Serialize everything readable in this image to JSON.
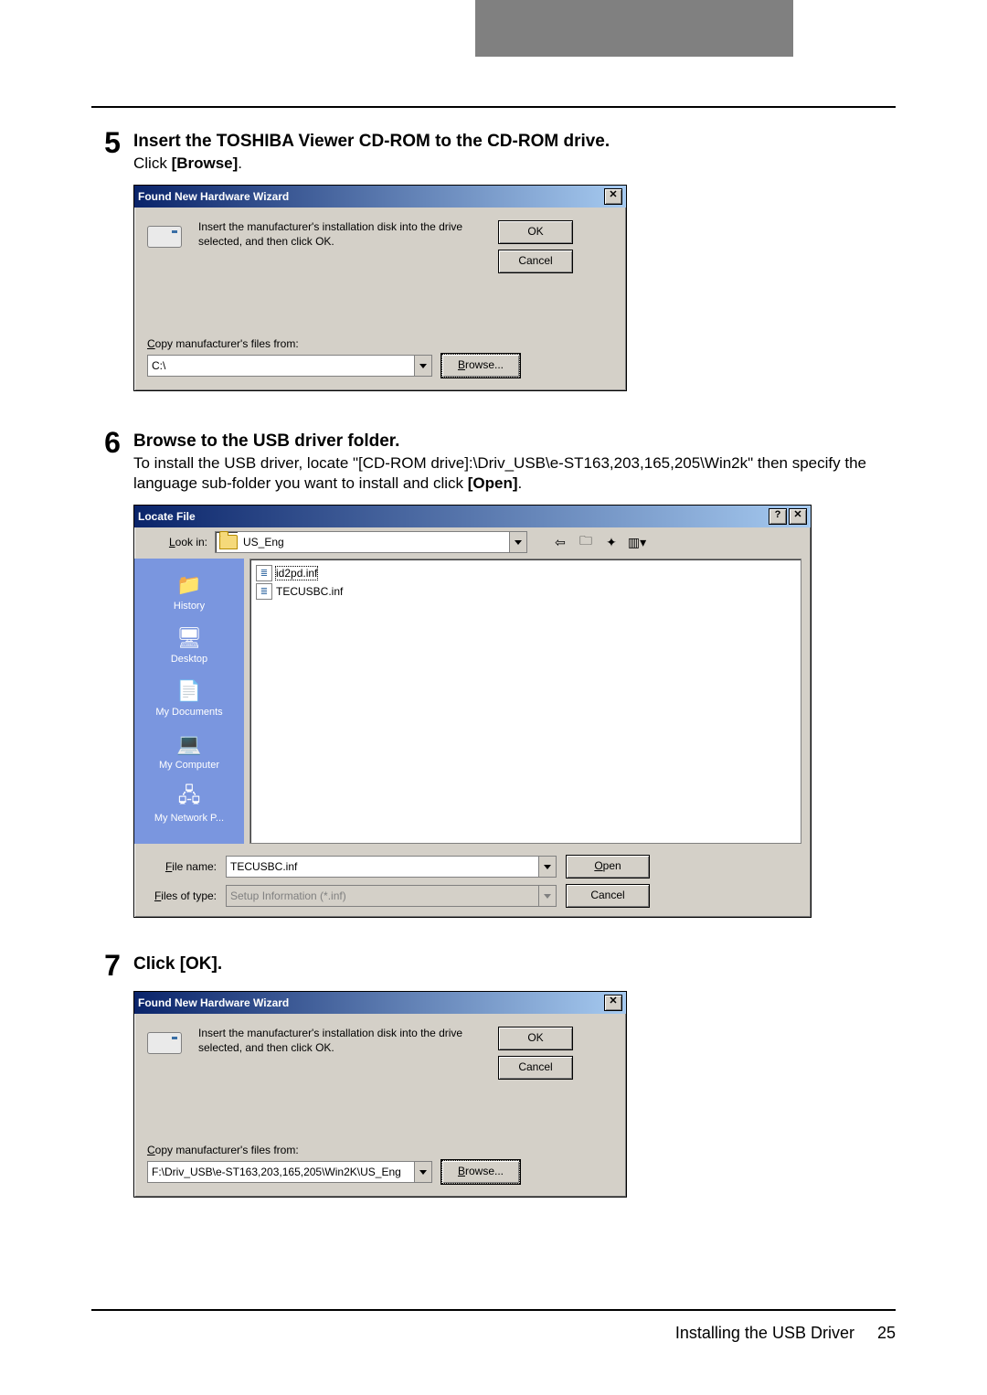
{
  "page": {
    "footer_section": "Installing the USB Driver",
    "footer_pageno": "25"
  },
  "steps": {
    "s5": {
      "num": "5",
      "title": "Insert the TOSHIBA Viewer CD-ROM to the CD-ROM drive.",
      "desc_prefix": "Click ",
      "desc_bold": "[Browse]",
      "desc_suffix": "."
    },
    "s6": {
      "num": "6",
      "title": "Browse to the USB driver folder.",
      "desc_part1": "To install the USB driver, locate \"[CD-ROM drive]:\\Driv_USB\\e-ST163,203,165,205\\Win2k\" then specify the language sub-folder you want to install and click ",
      "desc_bold": "[Open]",
      "desc_suffix": "."
    },
    "s7": {
      "num": "7",
      "title": "Click [OK]."
    }
  },
  "hw_dialog": {
    "title": "Found New Hardware Wizard",
    "message": "Insert the manufacturer's installation disk into the drive selected, and then click OK.",
    "ok": "OK",
    "cancel": "Cancel",
    "copy_label": "Copy manufacturer's files from:",
    "browse": "Browse...",
    "path1": "C:\\",
    "path2": "F:\\Driv_USB\\e-ST163,203,165,205\\Win2K\\US_Eng"
  },
  "locate_dialog": {
    "title": "Locate File",
    "lookin_label": "Look in:",
    "lookin_value": "US_Eng",
    "files": {
      "f1": "id2pd.inf",
      "f2": "TECUSBC.inf"
    },
    "places": {
      "p1": "History",
      "p2": "Desktop",
      "p3": "My Documents",
      "p4": "My Computer",
      "p5": "My Network P..."
    },
    "filename_label": "File name:",
    "filename_value": "TECUSBC.inf",
    "filetype_label": "Files of type:",
    "filetype_value": "Setup Information (*.inf)",
    "open": "Open",
    "cancel": "Cancel"
  },
  "glyphs": {
    "close": "✕",
    "help": "?",
    "back": "⇦",
    "up": "🗀",
    "new": "✦",
    "views": "▥▾"
  }
}
